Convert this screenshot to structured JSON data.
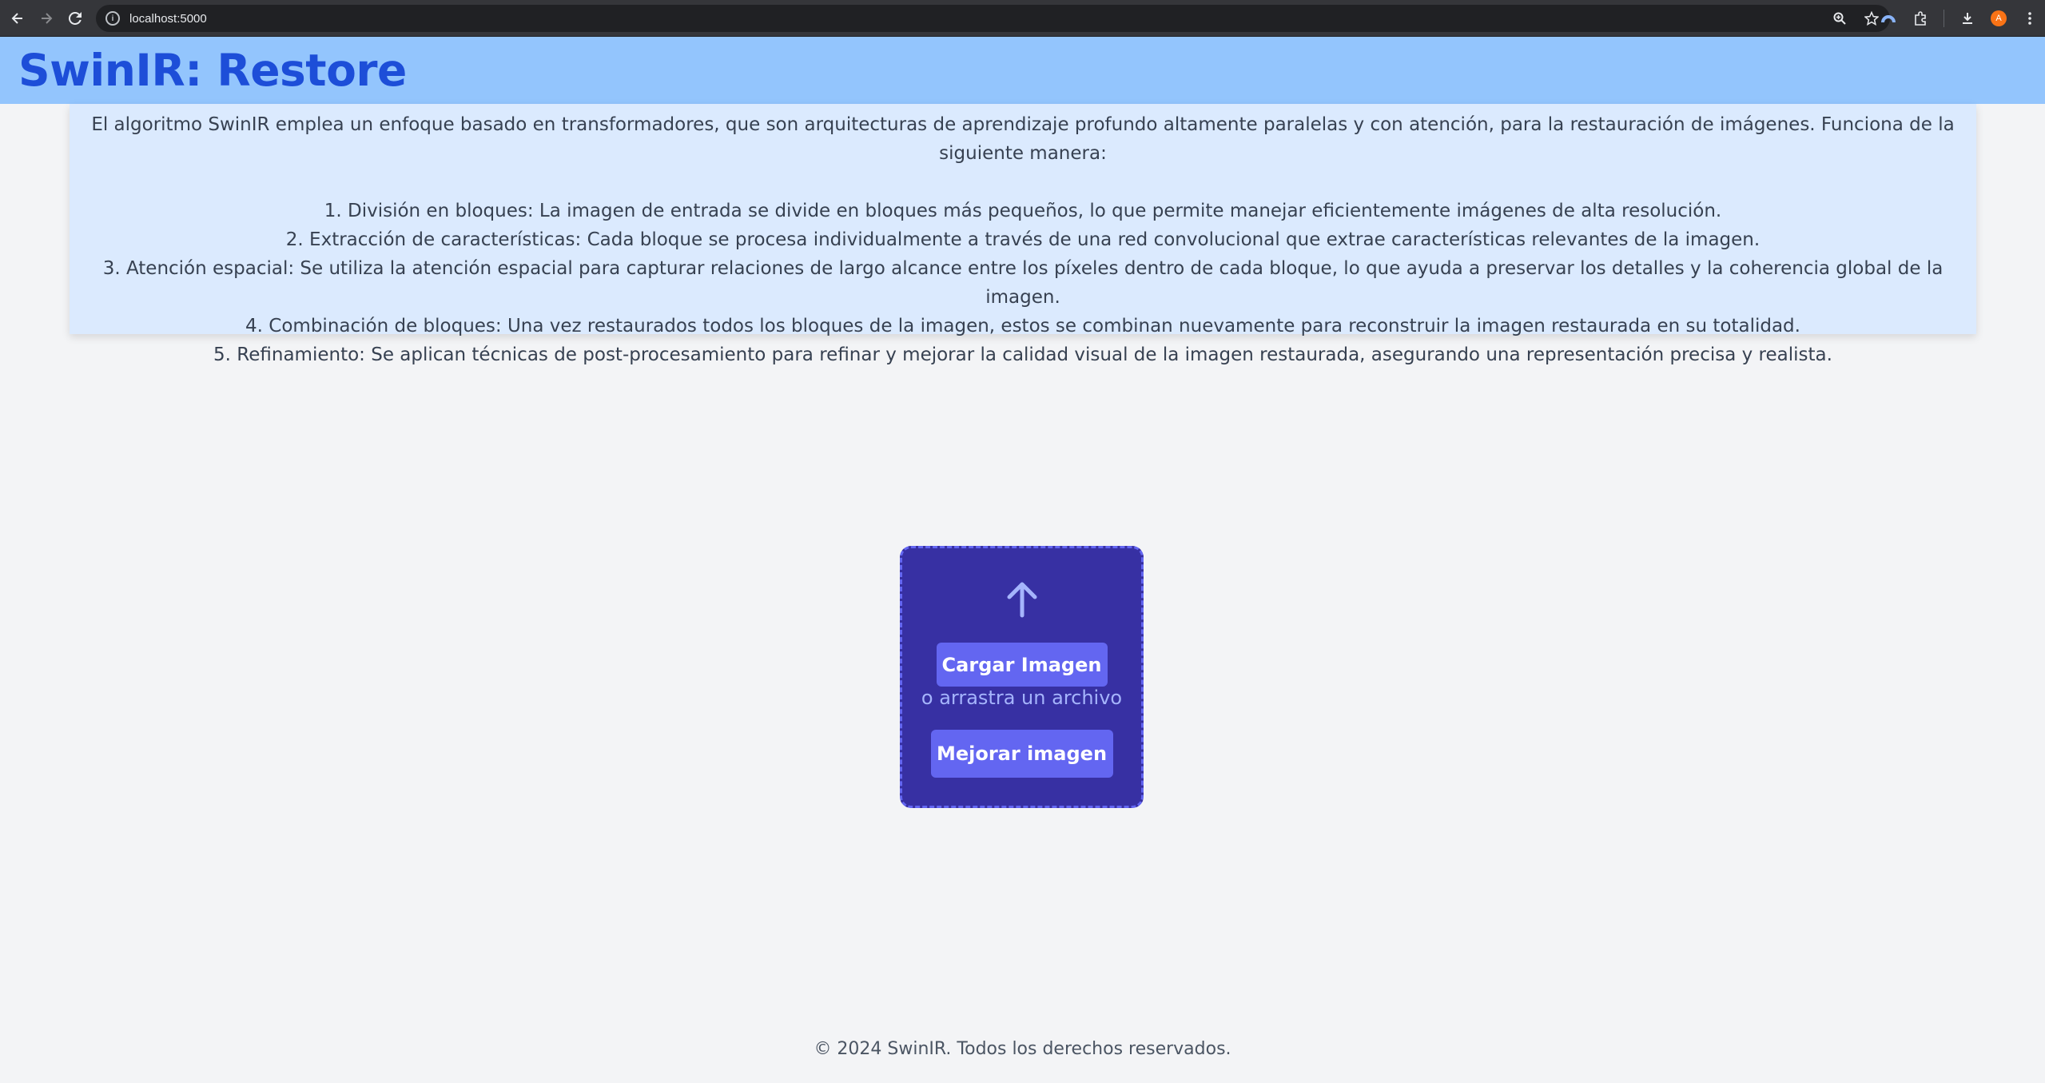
{
  "browser": {
    "url": "localhost:5000",
    "profile_initial": "A"
  },
  "header": {
    "title": "SwinIR: Restore"
  },
  "info": {
    "intro": "El algoritmo SwinIR emplea un enfoque basado en transformadores, que son arquitecturas de aprendizaje profundo altamente paralelas y con atención, para la restauración de imágenes. Funciona de la siguiente manera:",
    "steps": [
      "1. División en bloques: La imagen de entrada se divide en bloques más pequeños, lo que permite manejar eficientemente imágenes de alta resolución.",
      "2. Extracción de características: Cada bloque se procesa individualmente a través de una red convolucional que extrae características relevantes de la imagen.",
      "3. Atención espacial: Se utiliza la atención espacial para capturar relaciones de largo alcance entre los píxeles dentro de cada bloque, lo que ayuda a preservar los detalles y la coherencia global de la imagen.",
      "4. Combinación de bloques: Una vez restaurados todos los bloques de la imagen, estos se combinan nuevamente para reconstruir la imagen restaurada en su totalidad.",
      "5. Refinamiento: Se aplican técnicas de post-procesamiento para refinar y mejorar la calidad visual de la imagen restaurada, asegurando una representación precisa y realista."
    ]
  },
  "upload": {
    "icon": "arrow-up-icon",
    "upload_label": "Cargar Imagen",
    "drag_hint": "o arrastra un archivo",
    "enhance_label": "Mejorar imagen"
  },
  "footer": {
    "text": "© 2024 SwinIR. Todos los derechos reservados."
  },
  "colors": {
    "header_bg": "#93c5fd",
    "title": "#1d4ed8",
    "panel_bg": "#dbeafe",
    "upload_bg": "#3730a3",
    "button": "#6366f1"
  }
}
